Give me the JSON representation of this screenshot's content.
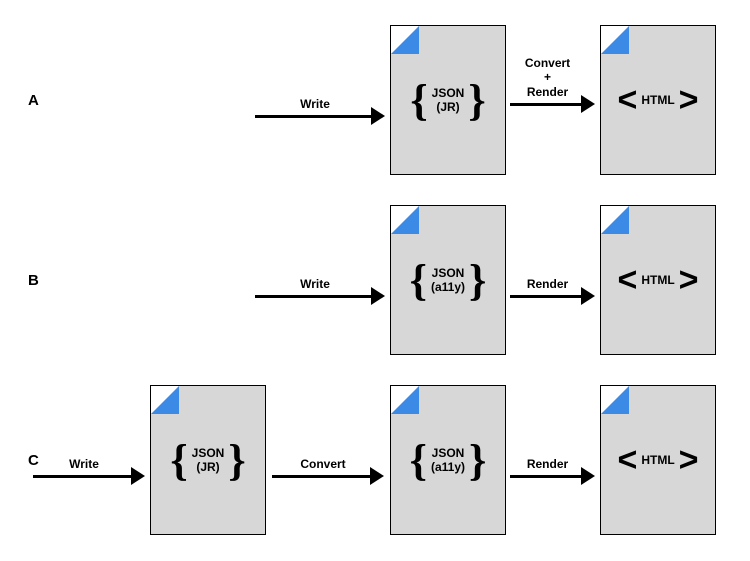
{
  "rows": {
    "a": {
      "label": "A",
      "arrow1": "Write",
      "arrow2": "Convert\n+\nRender",
      "doc1": {
        "line1": "JSON",
        "line2": "(JR)"
      },
      "doc2": {
        "line1": "HTML"
      }
    },
    "b": {
      "label": "B",
      "arrow1": "Write",
      "arrow2": "Render",
      "doc1": {
        "line1": "JSON",
        "line2": "(a11y)"
      },
      "doc2": {
        "line1": "HTML"
      }
    },
    "c": {
      "label": "C",
      "arrow0": "Write",
      "arrow1": "Convert",
      "arrow2": "Render",
      "doc0": {
        "line1": "JSON",
        "line2": "(JR)"
      },
      "doc1": {
        "line1": "JSON",
        "line2": "(a11y)"
      },
      "doc2": {
        "line1": "HTML"
      }
    }
  }
}
